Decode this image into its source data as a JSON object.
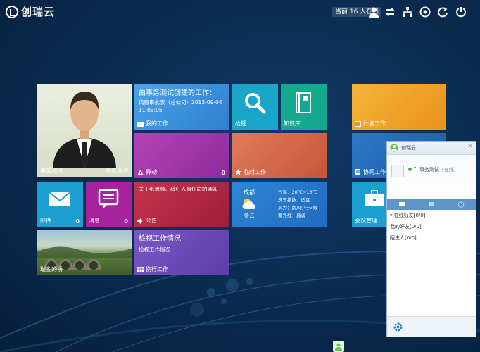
{
  "brand": {
    "name": "创瑞云"
  },
  "topbar": {
    "online_text": "当前 16 人在线",
    "icons": [
      "user-icon",
      "refresh-icon",
      "org-chart-icon",
      "settings-icon",
      "reload-icon",
      "power-icon"
    ]
  },
  "tiles": {
    "profile": {
      "left_label": "事务测试",
      "right_label": "事务测试"
    },
    "my_work": {
      "title": "由事务测试创建的工作：",
      "line1": "请假审批表（总公司）2013-09-04",
      "line2": "11:03:05",
      "label": "我的工作"
    },
    "inspect": {
      "label": "检视"
    },
    "knowledge": {
      "label": "知识库"
    },
    "plan": {
      "label": "计划工作"
    },
    "exception": {
      "label": "异动",
      "count": "0"
    },
    "temp_work": {
      "label": "临时工作"
    },
    "collab": {
      "label": "协同工作"
    },
    "mail": {
      "label": "邮件",
      "count": "0"
    },
    "message": {
      "label": "消息",
      "count": "0"
    },
    "notice": {
      "title": "关于毛遗顺、薛红人事任命的通知",
      "label": "公告"
    },
    "weather": {
      "city": "成都",
      "condition": "多云",
      "temp": "气温：20℃~13℃",
      "wash": "洗车指数：适宜",
      "wind": "风力：南风小于3级",
      "uv": "紫外线：最弱"
    },
    "meeting": {
      "label": "会议管理"
    },
    "photo": {
      "caption": "瑞金的桥"
    },
    "routine": {
      "title": "检视工作情况",
      "sub": "检视工作情况",
      "label": "例行工作"
    }
  },
  "chat_panel": {
    "title": "创瑞云",
    "user_name": "事务测试",
    "user_status": "[在线]",
    "groups": [
      "在线好友[0/0]",
      "我的好友[0/0]",
      "陌生人[0/0]"
    ]
  },
  "colors": {
    "bg": "#0b2a4e",
    "accent": "#4aa3df"
  }
}
